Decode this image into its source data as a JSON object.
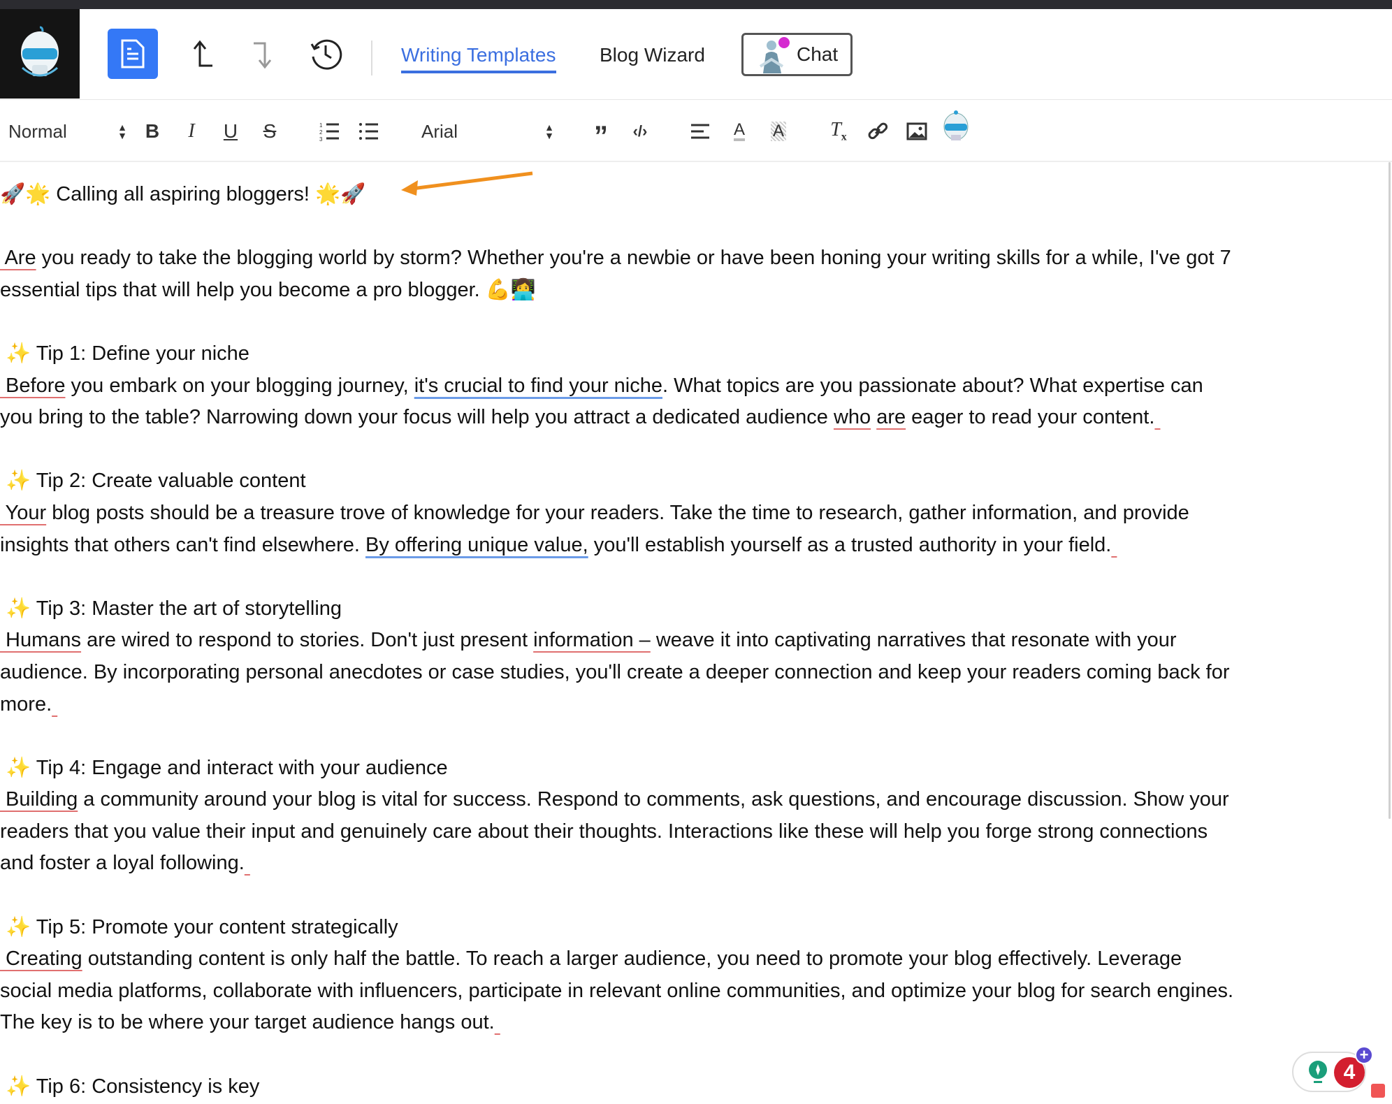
{
  "header": {
    "tabs": [
      {
        "label": "Writing Templates",
        "active": true
      },
      {
        "label": "Blog Wizard",
        "active": false
      }
    ],
    "chat_label": "Chat",
    "accent": "#3478f6"
  },
  "toolbar": {
    "paragraph_style": "Normal",
    "font": "Arial"
  },
  "content": {
    "lines": [
      [
        {
          "t": "🚀🌟 Calling all aspiring bloggers! 🌟🚀"
        }
      ],
      [],
      [
        {
          "t": " Are",
          "u": "red"
        },
        {
          "t": " you ready to take the blogging world by storm? Whether you're a newbie or have been honing your writing skills for a while, I've got 7"
        }
      ],
      [
        {
          "t": "essential tips that will help you become a pro blogger. 💪👩‍💻"
        }
      ],
      [],
      [
        {
          "t": " ✨ Tip 1: Define your niche"
        }
      ],
      [
        {
          "t": " Before",
          "u": "red"
        },
        {
          "t": " you embark on your blogging journey, "
        },
        {
          "t": "it's crucial to find your niche",
          "u": "blue"
        },
        {
          "t": ". What topics are you passionate about? What expertise can"
        }
      ],
      [
        {
          "t": "you bring to the table? Narrowing down your focus will help you attract a dedicated audience "
        },
        {
          "t": "who",
          "u": "red"
        },
        {
          "t": " "
        },
        {
          "t": "are",
          "u": "red"
        },
        {
          "t": " eager to read your content."
        },
        {
          "t": " ",
          "u": "red"
        }
      ],
      [],
      [
        {
          "t": " ✨ Tip 2: Create valuable content"
        }
      ],
      [
        {
          "t": " Your",
          "u": "red"
        },
        {
          "t": " blog posts should be a treasure trove of knowledge for your readers. Take the time to research, gather information, and provide"
        }
      ],
      [
        {
          "t": "insights that others can't find elsewhere. "
        },
        {
          "t": "By offering unique value,",
          "u": "blue"
        },
        {
          "t": " you'll establish yourself as a trusted authority in your field."
        },
        {
          "t": " ",
          "u": "red"
        }
      ],
      [],
      [
        {
          "t": " ✨ Tip 3: Master the art of storytelling"
        }
      ],
      [
        {
          "t": " Humans",
          "u": "red"
        },
        {
          "t": " are wired to respond to stories. Don't just present "
        },
        {
          "t": "information –",
          "u": "red"
        },
        {
          "t": " weave it into captivating narratives that resonate with your"
        }
      ],
      [
        {
          "t": "audience. By incorporating personal anecdotes or case studies, you'll create a deeper connection and keep your readers coming back for"
        }
      ],
      [
        {
          "t": "more."
        },
        {
          "t": " ",
          "u": "red"
        }
      ],
      [],
      [
        {
          "t": " ✨ Tip 4: Engage and interact with your audience"
        }
      ],
      [
        {
          "t": " Building",
          "u": "red"
        },
        {
          "t": " a community around your blog is vital for success. Respond to comments, ask questions, and encourage discussion. Show your"
        }
      ],
      [
        {
          "t": "readers that you value their input and genuinely care about their thoughts. Interactions like these will help you forge strong connections"
        }
      ],
      [
        {
          "t": "and foster a loyal following."
        },
        {
          "t": " ",
          "u": "red"
        }
      ],
      [],
      [
        {
          "t": " ✨ Tip 5: Promote your content strategically"
        }
      ],
      [
        {
          "t": " Creating",
          "u": "red"
        },
        {
          "t": " outstanding content is only half the battle. To reach a larger audience, you need to promote your blog effectively. Leverage"
        }
      ],
      [
        {
          "t": "social media platforms, collaborate with influencers, participate in relevant online communities, and optimize your blog for search engines."
        }
      ],
      [
        {
          "t": "The key is to be where your target audience hangs out."
        },
        {
          "t": " ",
          "u": "red"
        }
      ],
      [],
      [
        {
          "t": " ✨ Tip 6: Consistency is key"
        }
      ]
    ]
  },
  "widget": {
    "count": "4"
  }
}
